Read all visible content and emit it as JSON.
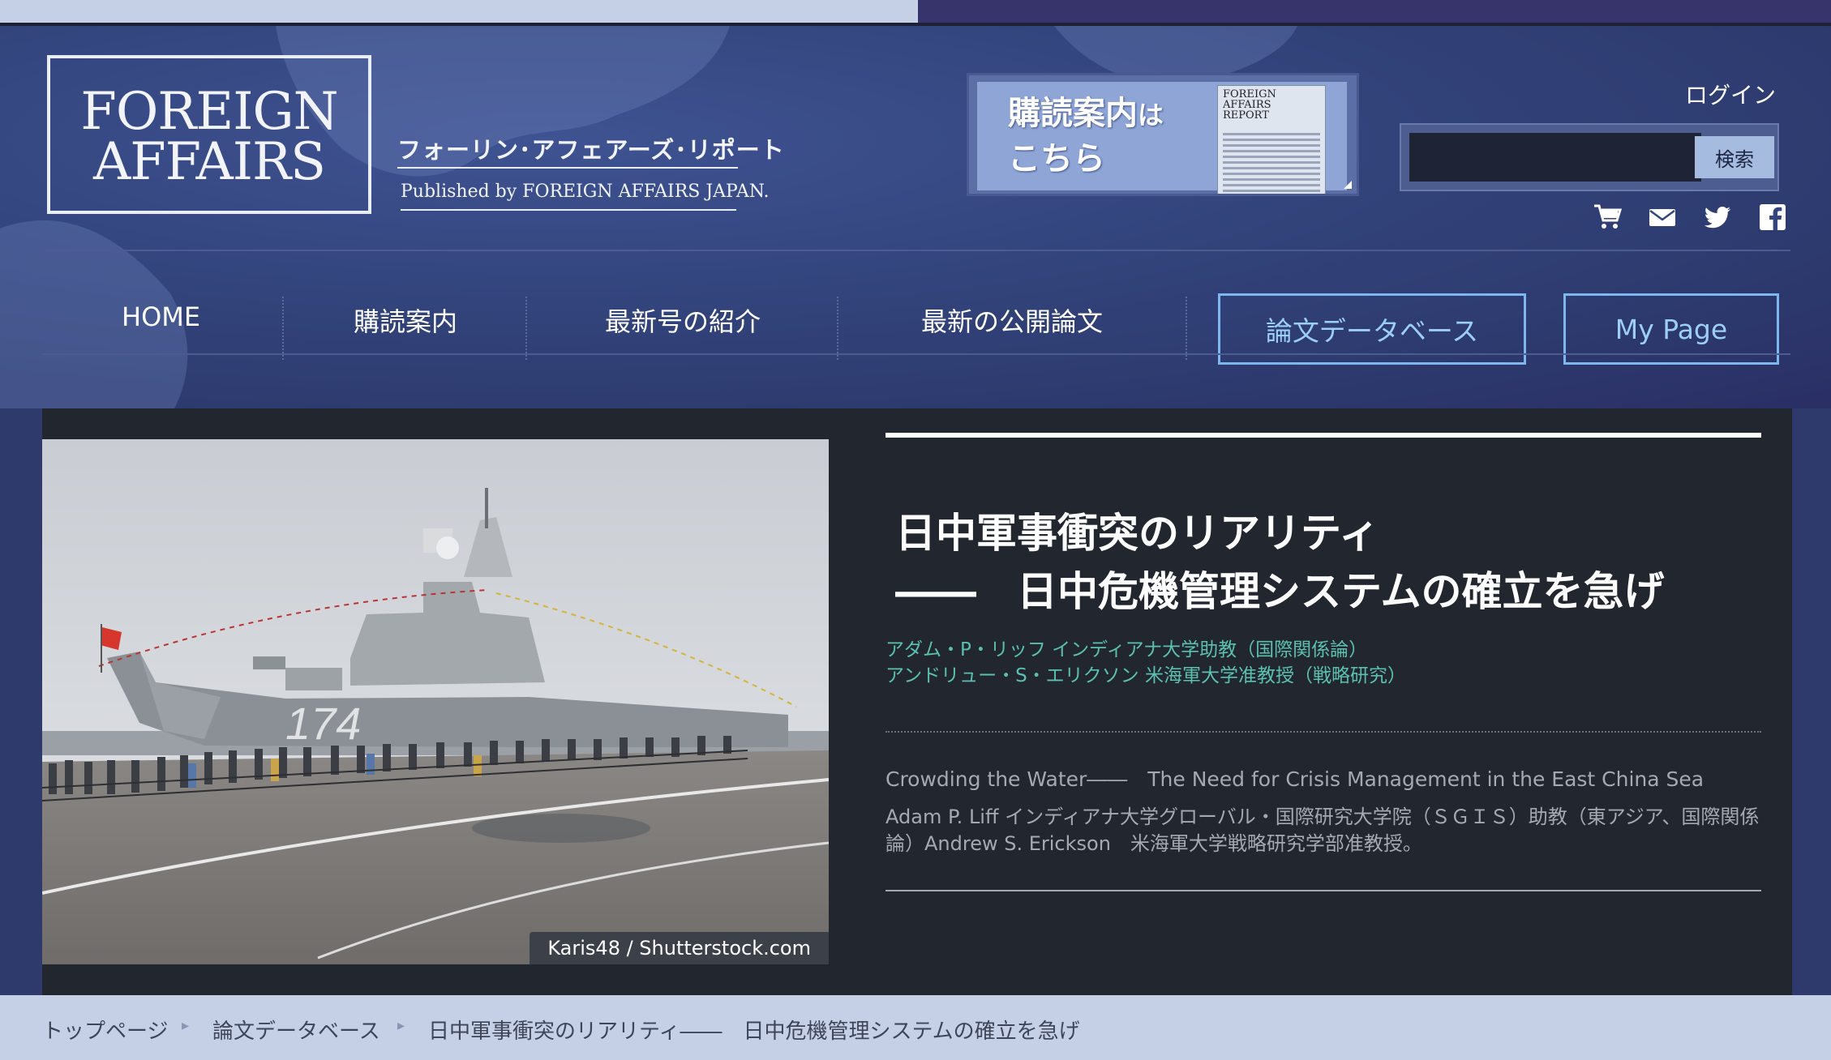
{
  "logo": {
    "line1": "FOREIGN",
    "line2": "AFFAIRS",
    "japanese": "フォーリン･アフェアーズ･リポート",
    "publisher": "Published by FOREIGN AFFAIRS JAPAN."
  },
  "banner": {
    "line1_main": "購読案内",
    "line1_small": "は",
    "line2": "こちら",
    "cover_title": "FOREIGN AFFAIRS REPORT"
  },
  "header": {
    "login": "ログイン",
    "search_button": "検索",
    "icons": [
      "cart-icon",
      "mail-icon",
      "twitter-icon",
      "facebook-icon"
    ]
  },
  "nav": {
    "items": [
      "HOME",
      "購読案内",
      "最新号の紹介",
      "最新の公開論文"
    ],
    "database": "論文データベース",
    "mypage": "My Page"
  },
  "article": {
    "title_line1": "日中軍事衝突のリアリティ",
    "title_line2": "――　日中危機管理システムの確立を急げ",
    "author1": "アダム・P・リッフ インディアナ大学助教（国際関係論）",
    "author2": "アンドリュー・S・エリクソン 米海軍大学准教授（戦略研究）",
    "english_title": "Crowding the Water――　The Need for Crisis Management in the East China Sea",
    "english_authors": "Adam P. Liff インディアナ大学グローバル・国際研究大学院（ＳＧＩＳ）助教（東アジア、国際関係論）Andrew S. Erickson　米海軍大学戦略研究学部准教授。",
    "photo_credit": "Karis48 / Shutterstock.com",
    "ship_number": "174"
  },
  "breadcrumb": {
    "items": [
      "トップページ",
      "論文データベース",
      "日中軍事衝突のリアリティ――　日中危機管理システムの確立を急げ"
    ],
    "separator": "▸"
  },
  "colors": {
    "header_bg": "#2e3a6b",
    "article_bg": "#22262f",
    "author_teal": "#5cc0b1",
    "nav_box_border": "#7eb6f0",
    "breadcrumb_bg": "#c5cfe6"
  }
}
